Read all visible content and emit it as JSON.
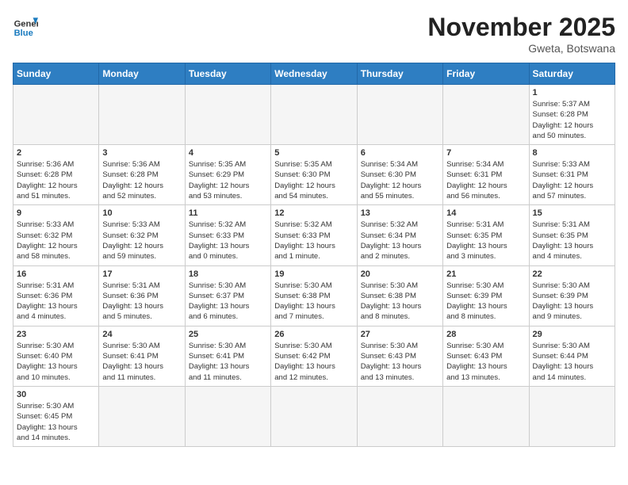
{
  "header": {
    "logo_general": "General",
    "logo_blue": "Blue",
    "month_title": "November 2025",
    "location": "Gweta, Botswana"
  },
  "days_of_week": [
    "Sunday",
    "Monday",
    "Tuesday",
    "Wednesday",
    "Thursday",
    "Friday",
    "Saturday"
  ],
  "weeks": [
    [
      {
        "day": "",
        "info": ""
      },
      {
        "day": "",
        "info": ""
      },
      {
        "day": "",
        "info": ""
      },
      {
        "day": "",
        "info": ""
      },
      {
        "day": "",
        "info": ""
      },
      {
        "day": "",
        "info": ""
      },
      {
        "day": "1",
        "info": "Sunrise: 5:37 AM\nSunset: 6:28 PM\nDaylight: 12 hours\nand 50 minutes."
      }
    ],
    [
      {
        "day": "2",
        "info": "Sunrise: 5:36 AM\nSunset: 6:28 PM\nDaylight: 12 hours\nand 51 minutes."
      },
      {
        "day": "3",
        "info": "Sunrise: 5:36 AM\nSunset: 6:28 PM\nDaylight: 12 hours\nand 52 minutes."
      },
      {
        "day": "4",
        "info": "Sunrise: 5:35 AM\nSunset: 6:29 PM\nDaylight: 12 hours\nand 53 minutes."
      },
      {
        "day": "5",
        "info": "Sunrise: 5:35 AM\nSunset: 6:30 PM\nDaylight: 12 hours\nand 54 minutes."
      },
      {
        "day": "6",
        "info": "Sunrise: 5:34 AM\nSunset: 6:30 PM\nDaylight: 12 hours\nand 55 minutes."
      },
      {
        "day": "7",
        "info": "Sunrise: 5:34 AM\nSunset: 6:31 PM\nDaylight: 12 hours\nand 56 minutes."
      },
      {
        "day": "8",
        "info": "Sunrise: 5:33 AM\nSunset: 6:31 PM\nDaylight: 12 hours\nand 57 minutes."
      }
    ],
    [
      {
        "day": "9",
        "info": "Sunrise: 5:33 AM\nSunset: 6:32 PM\nDaylight: 12 hours\nand 58 minutes."
      },
      {
        "day": "10",
        "info": "Sunrise: 5:33 AM\nSunset: 6:32 PM\nDaylight: 12 hours\nand 59 minutes."
      },
      {
        "day": "11",
        "info": "Sunrise: 5:32 AM\nSunset: 6:33 PM\nDaylight: 13 hours\nand 0 minutes."
      },
      {
        "day": "12",
        "info": "Sunrise: 5:32 AM\nSunset: 6:33 PM\nDaylight: 13 hours\nand 1 minute."
      },
      {
        "day": "13",
        "info": "Sunrise: 5:32 AM\nSunset: 6:34 PM\nDaylight: 13 hours\nand 2 minutes."
      },
      {
        "day": "14",
        "info": "Sunrise: 5:31 AM\nSunset: 6:35 PM\nDaylight: 13 hours\nand 3 minutes."
      },
      {
        "day": "15",
        "info": "Sunrise: 5:31 AM\nSunset: 6:35 PM\nDaylight: 13 hours\nand 4 minutes."
      }
    ],
    [
      {
        "day": "16",
        "info": "Sunrise: 5:31 AM\nSunset: 6:36 PM\nDaylight: 13 hours\nand 4 minutes."
      },
      {
        "day": "17",
        "info": "Sunrise: 5:31 AM\nSunset: 6:36 PM\nDaylight: 13 hours\nand 5 minutes."
      },
      {
        "day": "18",
        "info": "Sunrise: 5:30 AM\nSunset: 6:37 PM\nDaylight: 13 hours\nand 6 minutes."
      },
      {
        "day": "19",
        "info": "Sunrise: 5:30 AM\nSunset: 6:38 PM\nDaylight: 13 hours\nand 7 minutes."
      },
      {
        "day": "20",
        "info": "Sunrise: 5:30 AM\nSunset: 6:38 PM\nDaylight: 13 hours\nand 8 minutes."
      },
      {
        "day": "21",
        "info": "Sunrise: 5:30 AM\nSunset: 6:39 PM\nDaylight: 13 hours\nand 8 minutes."
      },
      {
        "day": "22",
        "info": "Sunrise: 5:30 AM\nSunset: 6:39 PM\nDaylight: 13 hours\nand 9 minutes."
      }
    ],
    [
      {
        "day": "23",
        "info": "Sunrise: 5:30 AM\nSunset: 6:40 PM\nDaylight: 13 hours\nand 10 minutes."
      },
      {
        "day": "24",
        "info": "Sunrise: 5:30 AM\nSunset: 6:41 PM\nDaylight: 13 hours\nand 11 minutes."
      },
      {
        "day": "25",
        "info": "Sunrise: 5:30 AM\nSunset: 6:41 PM\nDaylight: 13 hours\nand 11 minutes."
      },
      {
        "day": "26",
        "info": "Sunrise: 5:30 AM\nSunset: 6:42 PM\nDaylight: 13 hours\nand 12 minutes."
      },
      {
        "day": "27",
        "info": "Sunrise: 5:30 AM\nSunset: 6:43 PM\nDaylight: 13 hours\nand 13 minutes."
      },
      {
        "day": "28",
        "info": "Sunrise: 5:30 AM\nSunset: 6:43 PM\nDaylight: 13 hours\nand 13 minutes."
      },
      {
        "day": "29",
        "info": "Sunrise: 5:30 AM\nSunset: 6:44 PM\nDaylight: 13 hours\nand 14 minutes."
      }
    ],
    [
      {
        "day": "30",
        "info": "Sunrise: 5:30 AM\nSunset: 6:45 PM\nDaylight: 13 hours\nand 14 minutes."
      },
      {
        "day": "",
        "info": ""
      },
      {
        "day": "",
        "info": ""
      },
      {
        "day": "",
        "info": ""
      },
      {
        "day": "",
        "info": ""
      },
      {
        "day": "",
        "info": ""
      },
      {
        "day": "",
        "info": ""
      }
    ]
  ]
}
